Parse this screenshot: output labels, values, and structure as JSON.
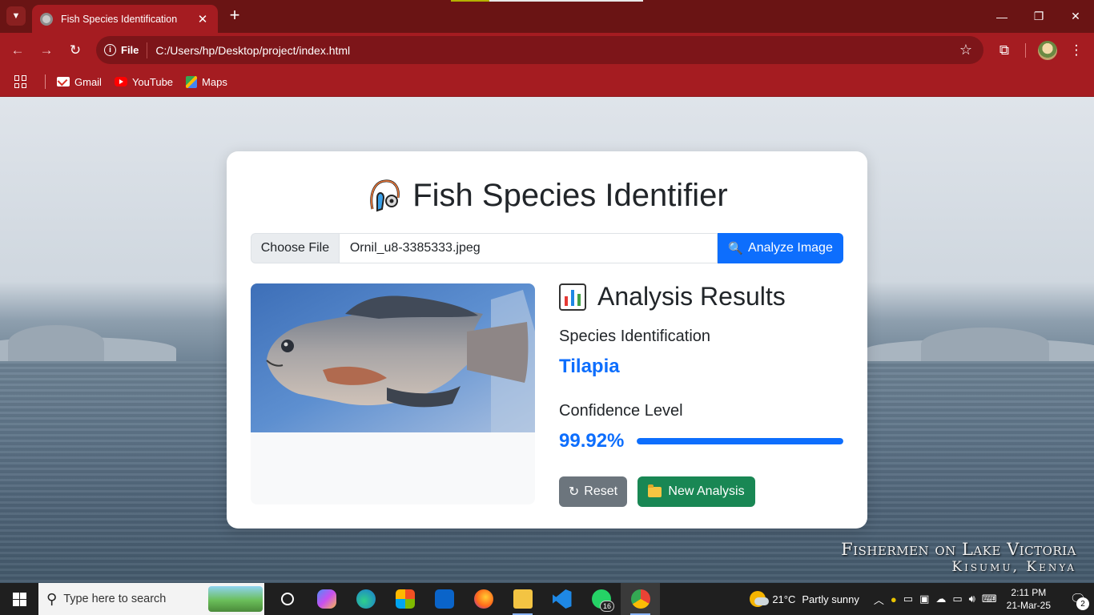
{
  "browser": {
    "tab_title": "Fish Species Identification",
    "tab_close": "✕",
    "new_tab": "+",
    "address_chip": "File",
    "url": "C:/Users/hp/Desktop/project/index.html",
    "bookmarks": [
      {
        "label": "Gmail",
        "icon": "gmail-icon"
      },
      {
        "label": "YouTube",
        "icon": "youtube-icon"
      },
      {
        "label": "Maps",
        "icon": "maps-icon"
      }
    ]
  },
  "page": {
    "title": "Fish Species Identifier",
    "upload": {
      "choose_label": "Choose File",
      "file_name": "Ornil_u8-3385333.jpeg",
      "analyze_label": "Analyze Image"
    },
    "results": {
      "heading": "Analysis Results",
      "species_label": "Species Identification",
      "species_value": "Tilapia",
      "confidence_label": "Confidence Level",
      "confidence_value": "99.92%",
      "confidence_fraction": 0.9992,
      "reset_label": "Reset",
      "reset_icon": "↻",
      "new_label": "New Analysis"
    },
    "background_watermark": {
      "line1": "Fishermen on Lake Victoria",
      "line2": "Kisumu, Kenya"
    }
  },
  "taskbar": {
    "search_placeholder": "Type here to search",
    "whatsapp_badge": "16",
    "weather_temp": "21°C",
    "weather_desc": "Partly sunny",
    "time": "2:11 PM",
    "date": "21-Mar-25",
    "notifications": "2"
  },
  "colors": {
    "accent": "#0d6efd",
    "browser_frame": "#a51c21",
    "reset_btn": "#6c757d",
    "new_btn": "#198754"
  }
}
